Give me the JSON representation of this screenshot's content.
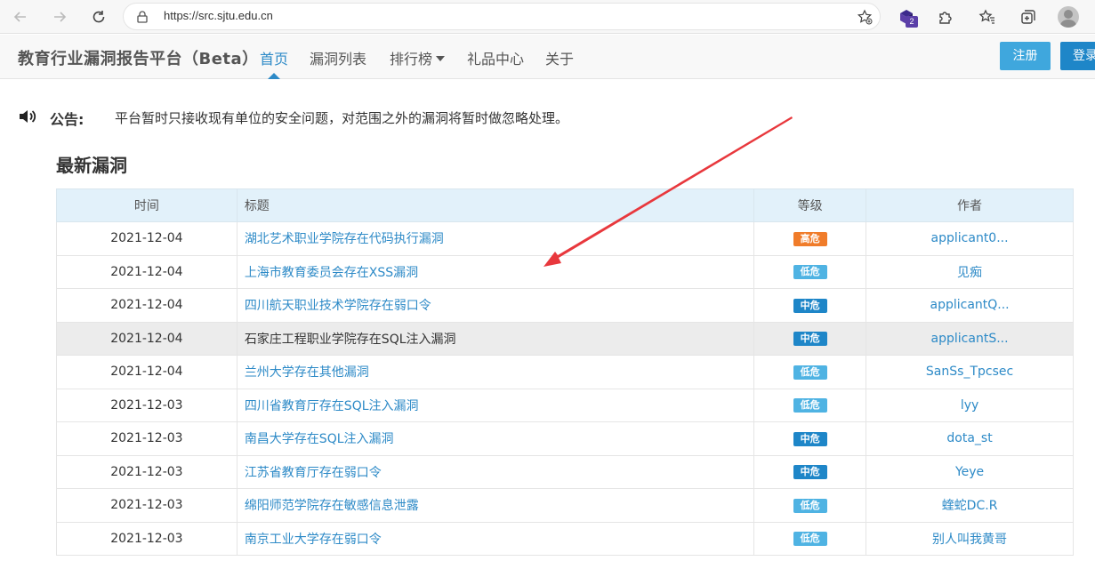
{
  "browser": {
    "url": "https://src.sjtu.edu.cn",
    "extension_badge": "2"
  },
  "header": {
    "brand": "教育行业漏洞报告平台（Beta）",
    "nav": [
      {
        "label": "首页"
      },
      {
        "label": "漏洞列表"
      },
      {
        "label": "排行榜"
      },
      {
        "label": "礼品中心"
      },
      {
        "label": "关于"
      }
    ],
    "register_label": "注册",
    "login_label": "登录"
  },
  "announcement": {
    "label": "公告:",
    "text": "平台暂时只接收现有单位的安全问题，对范围之外的漏洞将暂时做忽略处理。"
  },
  "section_title": "最新漏洞",
  "table": {
    "headers": {
      "time": "时间",
      "title": "标题",
      "level": "等级",
      "author": "作者"
    },
    "rows": [
      {
        "time": "2021-12-04",
        "title": "湖北艺术职业学院存在代码执行漏洞",
        "level": "高危",
        "author": "applicant0..."
      },
      {
        "time": "2021-12-04",
        "title": "上海市教育委员会存在XSS漏洞",
        "level": "低危",
        "author": "见痴"
      },
      {
        "time": "2021-12-04",
        "title": "四川航天职业技术学院存在弱口令",
        "level": "中危",
        "author": "applicantQ..."
      },
      {
        "time": "2021-12-04",
        "title": "石家庄工程职业学院存在SQL注入漏洞",
        "level": "中危",
        "author": "applicantS..."
      },
      {
        "time": "2021-12-04",
        "title": "兰州大学存在其他漏洞",
        "level": "低危",
        "author": "SanSs_Tpcsec"
      },
      {
        "time": "2021-12-03",
        "title": "四川省教育厅存在SQL注入漏洞",
        "level": "低危",
        "author": "lyy"
      },
      {
        "time": "2021-12-03",
        "title": "南昌大学存在SQL注入漏洞",
        "level": "中危",
        "author": "dota_st"
      },
      {
        "time": "2021-12-03",
        "title": "江苏省教育厅存在弱口令",
        "level": "中危",
        "author": "Yeye"
      },
      {
        "time": "2021-12-03",
        "title": "绵阳师范学院存在敏感信息泄露",
        "level": "低危",
        "author": "蝰蛇DC.R"
      },
      {
        "time": "2021-12-03",
        "title": "南京工业大学存在弱口令",
        "level": "低危",
        "author": "别人叫我黄哥"
      }
    ]
  },
  "colors": {
    "accent": "#2d8ac7",
    "high": "#f07c2a",
    "medium": "#1e86c8",
    "low": "#4fb3e3",
    "annotation_arrow": "#e8383d"
  }
}
